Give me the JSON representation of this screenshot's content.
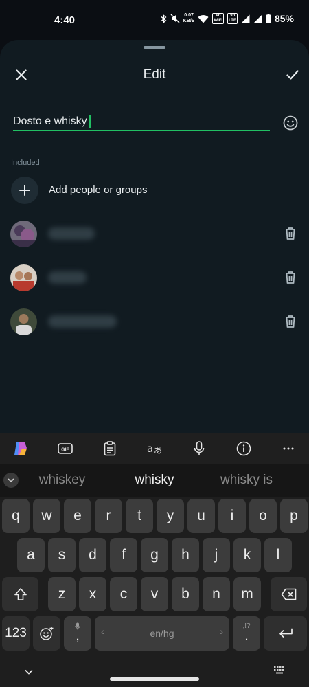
{
  "status": {
    "time": "4:40",
    "speed_value": "0.07",
    "speed_unit": "KB/S",
    "sim1_top": "Vo",
    "sim1_bottom": "WiFi",
    "sim2_top": "Vo",
    "sim2_bottom": "LTE",
    "battery": "85%"
  },
  "sheet": {
    "title": "Edit",
    "close_icon": "close-icon",
    "confirm_icon": "check-icon"
  },
  "name_field": {
    "value": "Dosto e whisky"
  },
  "included": {
    "label": "Included",
    "add_label": "Add people or groups"
  },
  "members": [
    {
      "avatar_colors": [
        "#5a4a6a",
        "#8a6a8a"
      ]
    },
    {
      "avatar_colors": [
        "#c9b9a8",
        "#a04030"
      ]
    },
    {
      "avatar_colors": [
        "#2a3a2a",
        "#cfcfcf"
      ]
    }
  ],
  "keyboard": {
    "suggestions": [
      "whiskey",
      "whisky",
      "whisky is"
    ],
    "row1": [
      "q",
      "w",
      "e",
      "r",
      "t",
      "y",
      "u",
      "i",
      "o",
      "p"
    ],
    "row2": [
      "a",
      "s",
      "d",
      "f",
      "g",
      "h",
      "j",
      "k",
      "l"
    ],
    "row3": [
      "z",
      "x",
      "c",
      "v",
      "b",
      "n",
      "m"
    ],
    "numbers_key": "123",
    "comma_key": ",",
    "space_label": "en/hg",
    "period_key": ".",
    "period_hint": ",!?"
  },
  "colors": {
    "accent": "#21c063",
    "sheet_bg": "#111b21",
    "keyboard_bg": "#1e1e1e"
  }
}
